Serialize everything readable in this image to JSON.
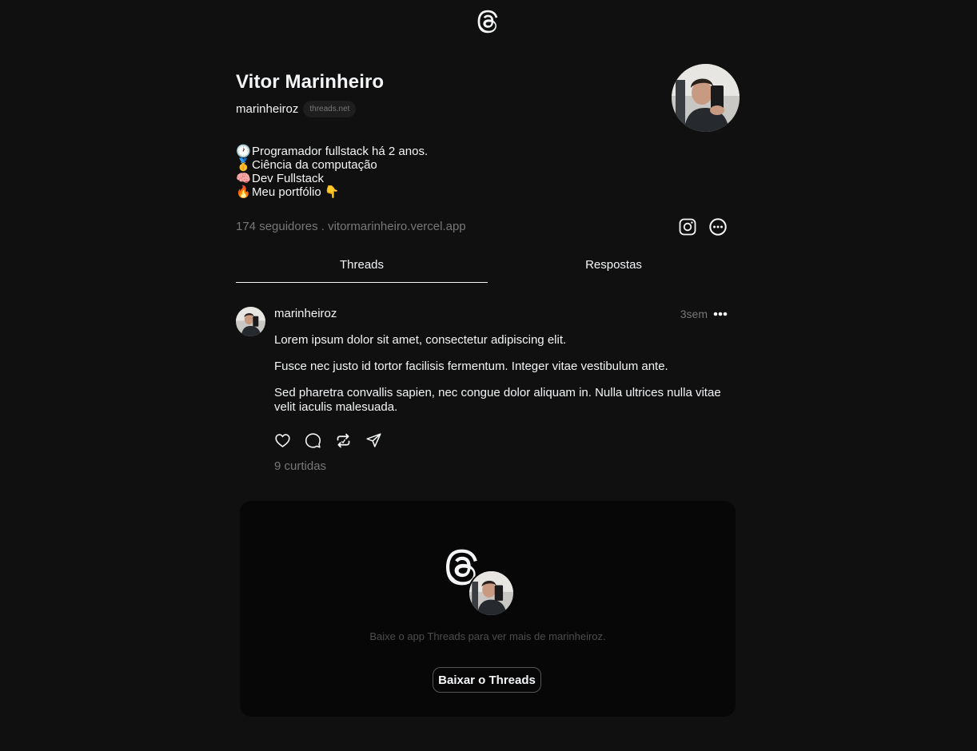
{
  "profile": {
    "name": "Vitor Marinheiro",
    "handle": "marinheiroz",
    "domain_badge": "threads.net",
    "bio": [
      {
        "emoji": "🕐",
        "text": "Programador fullstack há 2 anos."
      },
      {
        "emoji": "🥇",
        "text": "Ciência da computação"
      },
      {
        "emoji": "🧠",
        "text": "Dev Fullstack"
      },
      {
        "emoji": "🔥",
        "text": "Meu portfólio 👇"
      }
    ],
    "meta": "174 seguidores . vitormarinheiro.vercel.app"
  },
  "icons": {
    "logo": "threads-logo-icon",
    "instagram": "instagram-icon",
    "more": "more-circle-icon"
  },
  "tabs": [
    {
      "label": "Threads",
      "active": true
    },
    {
      "label": "Respostas",
      "active": false
    }
  ],
  "post": {
    "user": "marinheiroz",
    "time": "3sem",
    "paragraphs": [
      "Lorem ipsum dolor sit amet, consectetur adipiscing elit.",
      "Fusce nec justo id tortor facilisis fermentum. Integer vitae vestibulum ante.",
      "Sed pharetra convallis sapien, nec congue dolor aliquam in. Nulla ultrices nulla vitae velit iaculis malesuada."
    ],
    "likes": "9 curtidas"
  },
  "card": {
    "text": "Baixe o app Threads para ver mais de marinheiroz.",
    "button": "Baixar o Threads"
  },
  "colors": {
    "background": "#101010",
    "text": "#f3f5f7",
    "muted": "#777777",
    "card": "#070707"
  }
}
